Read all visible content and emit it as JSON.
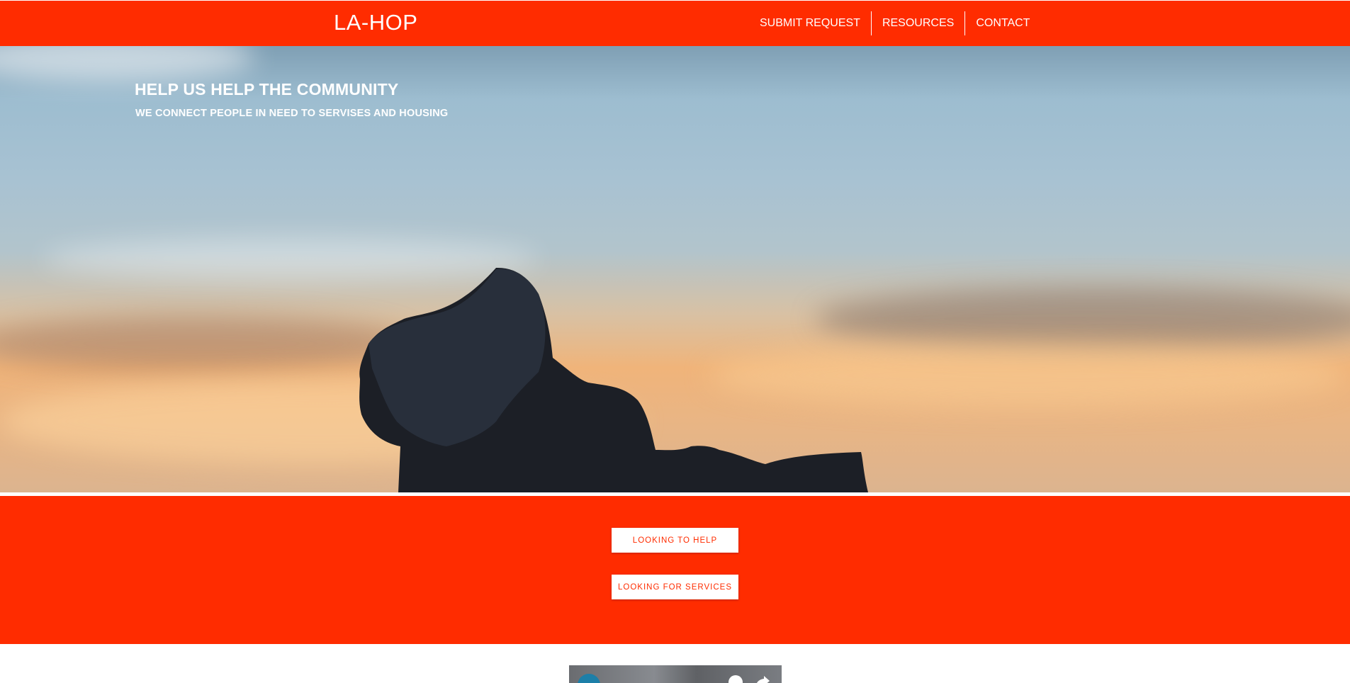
{
  "header": {
    "logo": "LA-HOP",
    "nav": [
      {
        "label": "SUBMIT REQUEST"
      },
      {
        "label": "RESOURCES"
      },
      {
        "label": "CONTACT"
      }
    ]
  },
  "hero": {
    "title": "HELP US HELP THE COMMUNITY",
    "subtitle": "WE CONNECT PEOPLE IN NEED TO SERVISES AND HOUSING"
  },
  "cta": {
    "help_label": "LOOKING TO HELP",
    "services_label": "LOOKING FOR SERVICES"
  },
  "video": {
    "icons": [
      "channel-avatar-icon",
      "info-icon",
      "share-icon"
    ]
  },
  "colors": {
    "brand": "#ff2c00",
    "text_on_brand": "#ffffff"
  }
}
